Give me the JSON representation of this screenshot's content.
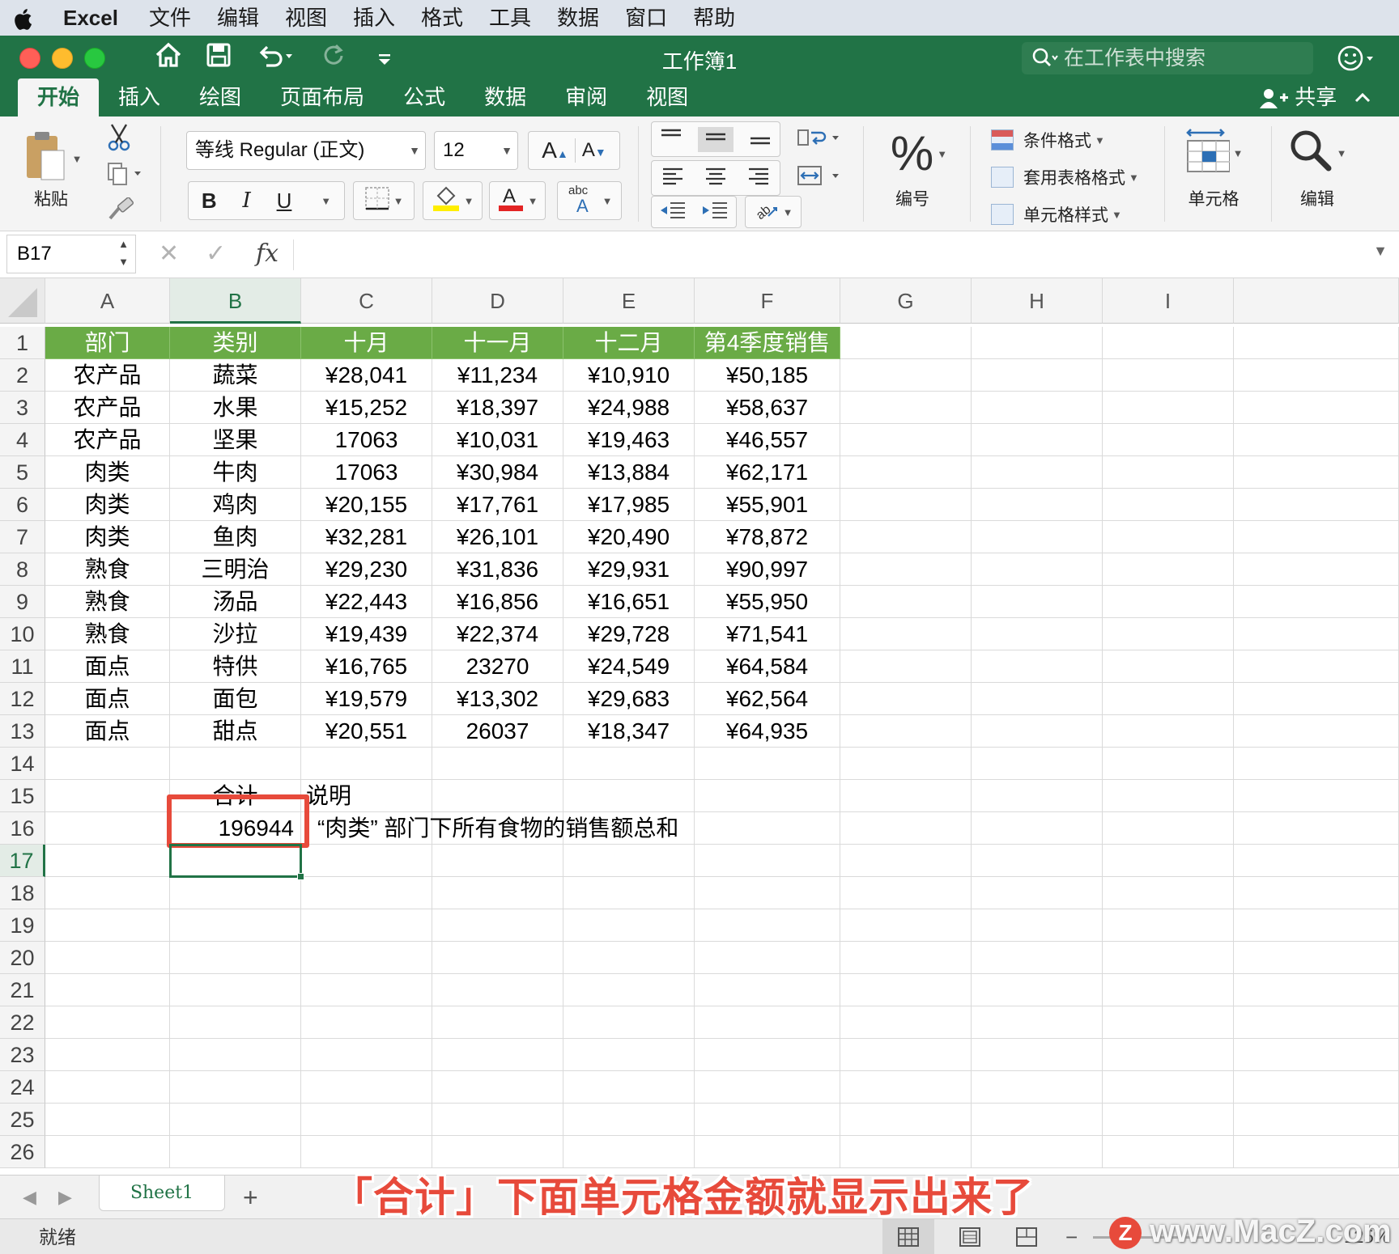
{
  "menubar": {
    "apple": "",
    "app": "Excel",
    "items": [
      "文件",
      "编辑",
      "视图",
      "插入",
      "格式",
      "工具",
      "数据",
      "窗口",
      "帮助"
    ]
  },
  "titlebar": {
    "title": "工作簿1",
    "search_placeholder": "在工作表中搜索",
    "share": "共享"
  },
  "tabs": [
    "开始",
    "插入",
    "绘图",
    "页面布局",
    "公式",
    "数据",
    "审阅",
    "视图"
  ],
  "ribbon": {
    "paste": "粘贴",
    "font_name": "等线 Regular (正文)",
    "font_size": "12",
    "bold": "B",
    "italic": "I",
    "underline": "U",
    "number": "编号",
    "cond_format": "条件格式",
    "table_format": "套用表格格式",
    "cell_style": "单元格样式",
    "cells": "单元格",
    "edit": "编辑"
  },
  "formula_bar": {
    "name_box": "B17",
    "fx": "fx",
    "value": ""
  },
  "columns": [
    "A",
    "B",
    "C",
    "D",
    "E",
    "F",
    "G",
    "H",
    "I"
  ],
  "rows": [
    "1",
    "2",
    "3",
    "4",
    "5",
    "6",
    "7",
    "8",
    "9",
    "10",
    "11",
    "12",
    "13",
    "14",
    "15",
    "16",
    "17",
    "18",
    "19",
    "20",
    "21",
    "22",
    "23",
    "24",
    "25",
    "26"
  ],
  "table": {
    "header": [
      "部门",
      "类别",
      "十月",
      "十一月",
      "十二月",
      "第4季度销售"
    ],
    "rows": [
      [
        "农产品",
        "蔬菜",
        "¥28,041",
        "¥11,234",
        "¥10,910",
        "¥50,185"
      ],
      [
        "农产品",
        "水果",
        "¥15,252",
        "¥18,397",
        "¥24,988",
        "¥58,637"
      ],
      [
        "农产品",
        "坚果",
        "17063",
        "¥10,031",
        "¥19,463",
        "¥46,557"
      ],
      [
        "肉类",
        "牛肉",
        "17063",
        "¥30,984",
        "¥13,884",
        "¥62,171"
      ],
      [
        "肉类",
        "鸡肉",
        "¥20,155",
        "¥17,761",
        "¥17,985",
        "¥55,901"
      ],
      [
        "肉类",
        "鱼肉",
        "¥32,281",
        "¥26,101",
        "¥20,490",
        "¥78,872"
      ],
      [
        "熟食",
        "三明治",
        "¥29,230",
        "¥31,836",
        "¥29,931",
        "¥90,997"
      ],
      [
        "熟食",
        "汤品",
        "¥22,443",
        "¥16,856",
        "¥16,651",
        "¥55,950"
      ],
      [
        "熟食",
        "沙拉",
        "¥19,439",
        "¥22,374",
        "¥29,728",
        "¥71,541"
      ],
      [
        "面点",
        "特供",
        "¥16,765",
        "23270",
        "¥24,549",
        "¥64,584"
      ],
      [
        "面点",
        "面包",
        "¥19,579",
        "¥13,302",
        "¥29,683",
        "¥62,564"
      ],
      [
        "面点",
        "甜点",
        "¥20,551",
        "26037",
        "¥18,347",
        "¥64,935"
      ]
    ]
  },
  "summary": {
    "total_label": "合计",
    "note_label": "说明",
    "total_value": "196944",
    "note": "“肉类” 部门下所有食物的销售额总和"
  },
  "sheet_tab": "Sheet1",
  "status": "就绪",
  "zoom": "125%",
  "caption": "「合计」下面单元格金额就显示出来了",
  "watermark": "www.MacZ.com",
  "watermark_letter": "Z",
  "colors": {
    "ribbon_green": "#217346",
    "table_header": "#6aab46",
    "highlight_red": "#e74a3b"
  }
}
